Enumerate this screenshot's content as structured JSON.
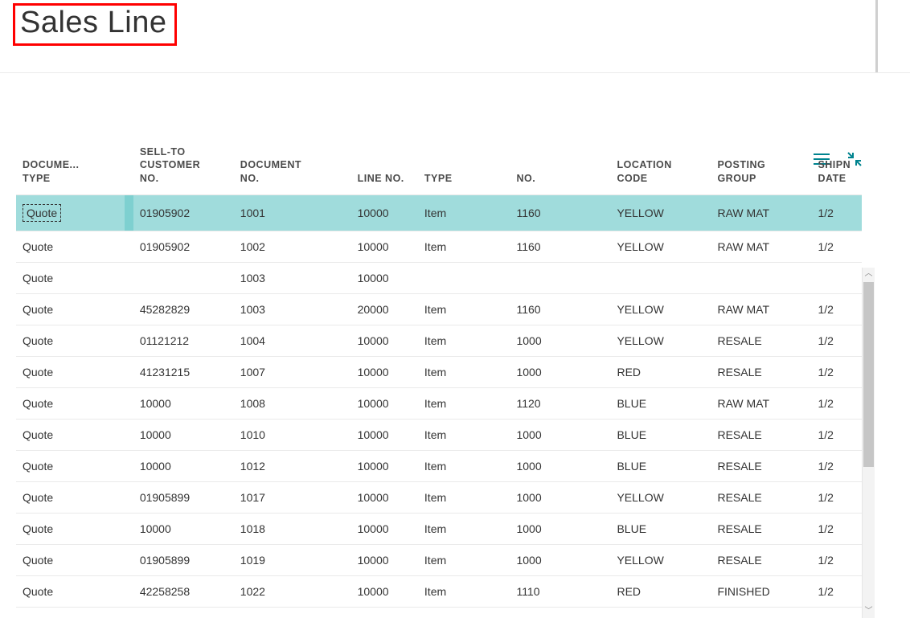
{
  "page": {
    "title": "Sales Line"
  },
  "toolbar": {
    "list_icon": "list-icon",
    "collapse_icon": "collapse-icon"
  },
  "table": {
    "headers": {
      "document_type": "DOCUME...\nTYPE",
      "sell_to_customer_no": "SELL-TO\nCUSTOMER\nNO.",
      "document_no": "DOCUMENT\nNO.",
      "line_no": "LINE NO.",
      "type": "TYPE",
      "no": "NO.",
      "location_code": "LOCATION\nCODE",
      "posting_group": "POSTING\nGROUP",
      "shipment_date": "SHIPN\nDATE"
    },
    "rows": [
      {
        "document_type": "Quote",
        "sell_to_customer_no": "01905902",
        "document_no": "1001",
        "line_no": "10000",
        "type": "Item",
        "no": "1160",
        "location_code": "YELLOW",
        "posting_group": "RAW MAT",
        "shipment_date": "1/2"
      },
      {
        "document_type": "Quote",
        "sell_to_customer_no": "01905902",
        "document_no": "1002",
        "line_no": "10000",
        "type": "Item",
        "no": "1160",
        "location_code": "YELLOW",
        "posting_group": "RAW MAT",
        "shipment_date": "1/2"
      },
      {
        "document_type": "Quote",
        "sell_to_customer_no": "",
        "document_no": "1003",
        "line_no": "10000",
        "type": "",
        "no": "",
        "location_code": "",
        "posting_group": "",
        "shipment_date": ""
      },
      {
        "document_type": "Quote",
        "sell_to_customer_no": "45282829",
        "document_no": "1003",
        "line_no": "20000",
        "type": "Item",
        "no": "1160",
        "location_code": "YELLOW",
        "posting_group": "RAW MAT",
        "shipment_date": "1/2"
      },
      {
        "document_type": "Quote",
        "sell_to_customer_no": "01121212",
        "document_no": "1004",
        "line_no": "10000",
        "type": "Item",
        "no": "1000",
        "location_code": "YELLOW",
        "posting_group": "RESALE",
        "shipment_date": "1/2"
      },
      {
        "document_type": "Quote",
        "sell_to_customer_no": "41231215",
        "document_no": "1007",
        "line_no": "10000",
        "type": "Item",
        "no": "1000",
        "location_code": "RED",
        "posting_group": "RESALE",
        "shipment_date": "1/2"
      },
      {
        "document_type": "Quote",
        "sell_to_customer_no": "10000",
        "document_no": "1008",
        "line_no": "10000",
        "type": "Item",
        "no": "1120",
        "location_code": "BLUE",
        "posting_group": "RAW MAT",
        "shipment_date": "1/2"
      },
      {
        "document_type": "Quote",
        "sell_to_customer_no": "10000",
        "document_no": "1010",
        "line_no": "10000",
        "type": "Item",
        "no": "1000",
        "location_code": "BLUE",
        "posting_group": "RESALE",
        "shipment_date": "1/2"
      },
      {
        "document_type": "Quote",
        "sell_to_customer_no": "10000",
        "document_no": "1012",
        "line_no": "10000",
        "type": "Item",
        "no": "1000",
        "location_code": "BLUE",
        "posting_group": "RESALE",
        "shipment_date": "1/2"
      },
      {
        "document_type": "Quote",
        "sell_to_customer_no": "01905899",
        "document_no": "1017",
        "line_no": "10000",
        "type": "Item",
        "no": "1000",
        "location_code": "YELLOW",
        "posting_group": "RESALE",
        "shipment_date": "1/2"
      },
      {
        "document_type": "Quote",
        "sell_to_customer_no": "10000",
        "document_no": "1018",
        "line_no": "10000",
        "type": "Item",
        "no": "1000",
        "location_code": "BLUE",
        "posting_group": "RESALE",
        "shipment_date": "1/2"
      },
      {
        "document_type": "Quote",
        "sell_to_customer_no": "01905899",
        "document_no": "1019",
        "line_no": "10000",
        "type": "Item",
        "no": "1000",
        "location_code": "YELLOW",
        "posting_group": "RESALE",
        "shipment_date": "1/2"
      },
      {
        "document_type": "Quote",
        "sell_to_customer_no": "42258258",
        "document_no": "1022",
        "line_no": "10000",
        "type": "Item",
        "no": "1110",
        "location_code": "RED",
        "posting_group": "FINISHED",
        "shipment_date": "1/2"
      }
    ],
    "selected_index": 0
  }
}
